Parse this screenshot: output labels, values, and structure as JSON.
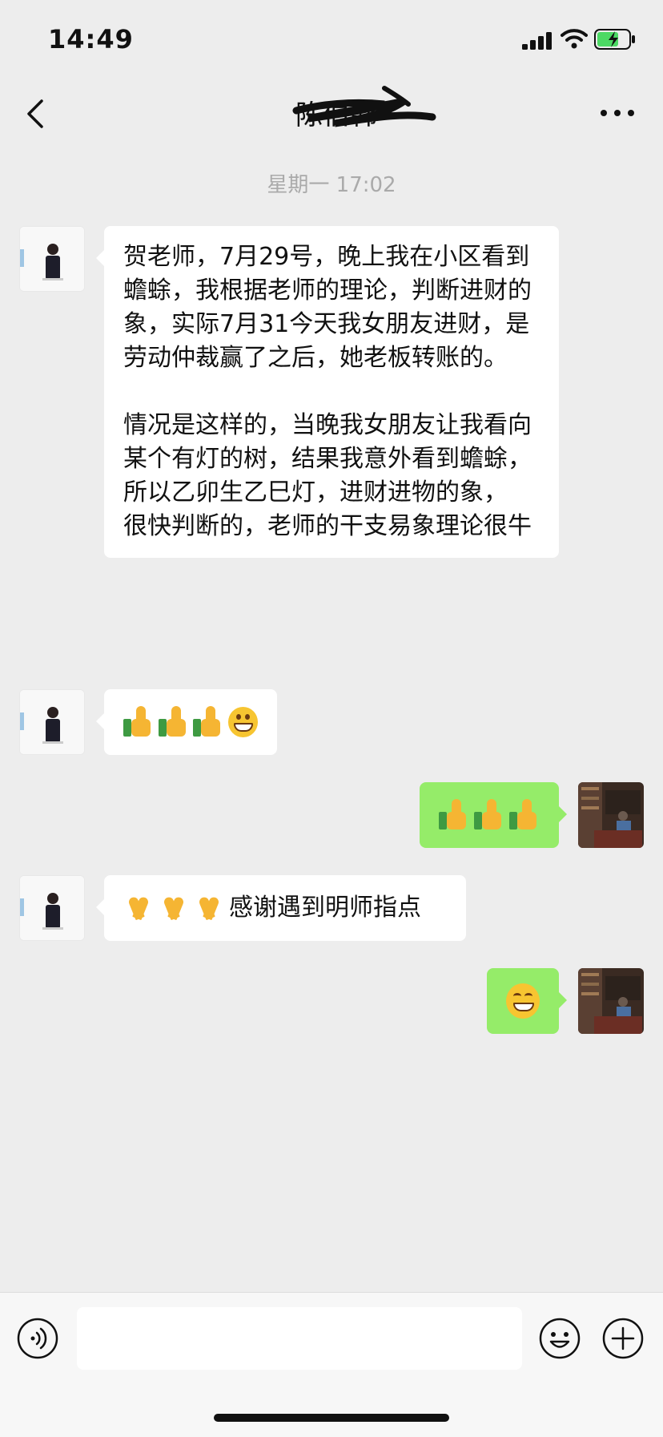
{
  "status_bar": {
    "time": "14:49"
  },
  "header": {
    "title": "陈伯韩",
    "back_icon": "chevron-left-icon",
    "more_icon": "more-dots-icon"
  },
  "conversation": {
    "timestamp": "星期一 17:02",
    "messages": [
      {
        "side": "left",
        "text": "贺老师，7月29号，晚上我在小区看到蟾蜍，我根据老师的理论，判断进财的象，实际7月31今天我女朋友进财，是劳动仲裁赢了之后，她老板转账的。\n\n情况是这样的，当晚我女朋友让我看向某个有灯的树，结果我意外看到蟾蜍，所以乙卯生乙巳灯，进财进物的象，\n很快判断的，老师的干支易象理论很牛"
      },
      {
        "side": "left",
        "emojis": [
          "thumbs-up",
          "thumbs-up",
          "thumbs-up",
          "grinning-face"
        ]
      },
      {
        "side": "right",
        "emojis": [
          "thumbs-up",
          "thumbs-up",
          "thumbs-up"
        ]
      },
      {
        "side": "left",
        "emojis": [
          "folded-hands",
          "folded-hands",
          "folded-hands"
        ],
        "text": "感谢遇到明师指点"
      },
      {
        "side": "right",
        "emojis": [
          "smiling-face"
        ]
      }
    ]
  },
  "input_bar": {
    "value": "",
    "icons": [
      "voice-icon",
      "emoji-icon",
      "plus-icon"
    ]
  },
  "colors": {
    "background": "#ededed",
    "outgoing_bubble": "#95ec69",
    "incoming_bubble": "#ffffff",
    "timestamp": "#aaaaaa",
    "battery_charging": "#4cd964"
  }
}
